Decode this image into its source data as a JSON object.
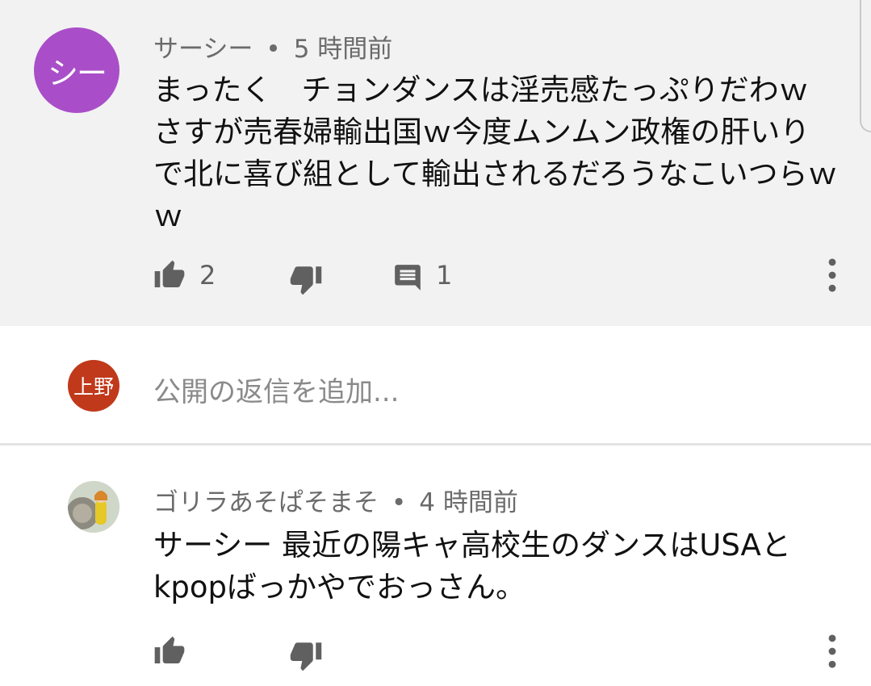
{
  "comments": [
    {
      "author": "サーシー",
      "separator": "•",
      "time": "5 時間前",
      "text": "まったく　チョンダンスは淫売感たっぷりだわｗ　さすが売春婦輸出国ｗ今度ムンムン政権の肝いりで北に喜び組として輸出されるだろうなこいつらｗｗ",
      "avatar_text": "シー",
      "avatar_color": "#a94ec8",
      "likes": "2",
      "replies": "1"
    },
    {
      "author": "ゴリラあそぱそまそ",
      "separator": "•",
      "time": "4 時間前",
      "text": "サーシー 最近の陽キャ高校生のダンスはUSAとkpopばっかやでおっさん。"
    }
  ],
  "reply_box": {
    "avatar_text": "上野",
    "avatar_color": "#c0391b",
    "placeholder": "公開の返信を追加..."
  },
  "icons": [
    "thumbs-up-icon",
    "thumbs-down-icon",
    "comment-icon",
    "more-vert-icon"
  ]
}
